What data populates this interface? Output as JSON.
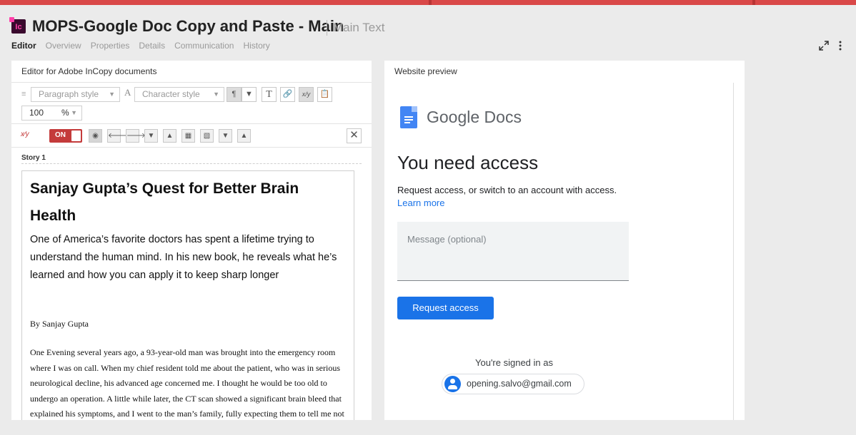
{
  "header": {
    "title": "MOPS-Google Doc Copy and Paste - Main",
    "subtitle": "Main Text",
    "icon": "incopy-doc-icon",
    "icon_letters": "Ic",
    "accent_color": "#d94848"
  },
  "tabs": [
    {
      "label": "Editor",
      "active": true
    },
    {
      "label": "Overview"
    },
    {
      "label": "Properties"
    },
    {
      "label": "Details"
    },
    {
      "label": "Communication"
    },
    {
      "label": "History"
    }
  ],
  "editor": {
    "panel_title": "Editor for Adobe InCopy documents",
    "paragraph_style_placeholder": "Paragraph style",
    "character_style_placeholder": "Character style",
    "zoom_value": "100",
    "zoom_unit": "%",
    "track_changes_label": "ON",
    "story_label": "Story 1",
    "document": {
      "headline": "Sanjay Gupta’s Quest for Better Brain Health",
      "deck": "One of America’s favorite doctors has spent a lifetime trying to understand the human mind. In his new book, he reveals what he’s learned and how you can apply it to keep sharp longer",
      "byline": "By Sanjay Gupta",
      "body": "One Evening several years ago, a 93-year-old man was brought into the emergency room where I was on call. When my chief resident told me about the patient, who was in serious neurological decline, his advanced age concerned me. I thought he would be too old to undergo an operation. A little while later, the CT scan showed a significant brain bleed that explained his symptoms, and I went to the man’s family, fully expecting them to tell me not"
    }
  },
  "preview": {
    "panel_title": "Website preview",
    "brand": "Google Docs",
    "heading": "You need access",
    "description": "Request access, or switch to an account with access.",
    "learn_more": "Learn more",
    "message_placeholder": "Message (optional)",
    "request_button": "Request access",
    "signed_in_label": "You're signed in as",
    "email": "opening.salvo@gmail.com"
  }
}
